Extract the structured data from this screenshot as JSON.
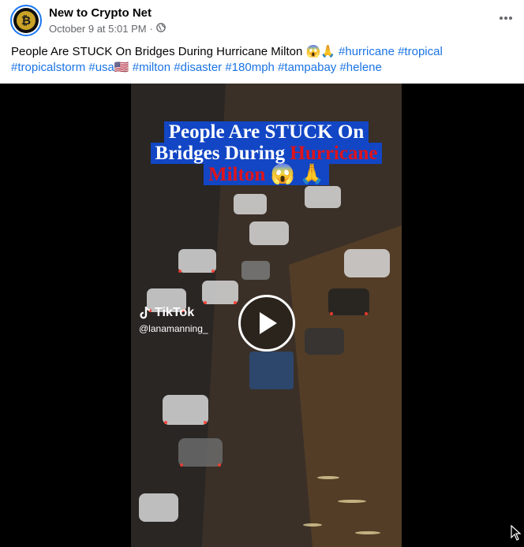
{
  "post": {
    "author": "New to Crypto Net",
    "timestamp": "October 9 at 5:01 PM",
    "separator": "·",
    "privacy_icon": "globe-icon",
    "more_icon": "more-dots-icon",
    "avatar_icon": "bitcoin-logo",
    "caption_text": "People Are STUCK On Bridges During Hurricane Milton 😱🙏",
    "hashtags": [
      "#hurricane",
      "#tropical",
      "#tropicalstorm",
      "#usa🇺🇸",
      "#milton",
      "#disaster",
      "#180mph",
      "#tampabay",
      "#helene"
    ]
  },
  "video": {
    "title_line1": "People Are STUCK On",
    "title_line2_a": "Bridges During ",
    "title_line2_b": "Hurricane",
    "title_line3_a": "Milton",
    "title_line3_b": " 😱 🙏",
    "watermark_brand": "TikTok",
    "watermark_user": "@lanamanning_",
    "play_icon": "play-icon",
    "colors": {
      "title_bg": "#1246c5",
      "title_red": "#e0131b"
    }
  },
  "colors": {
    "link": "#1b74e4",
    "meta": "#65676b",
    "avatar_ring": "#1877f2"
  }
}
